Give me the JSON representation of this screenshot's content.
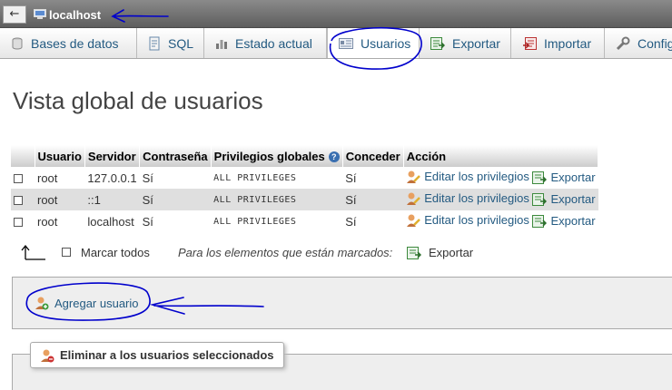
{
  "topbar": {
    "back_label": "←",
    "server_name": "localhost"
  },
  "tabs": [
    {
      "label": "Bases de datos",
      "icon": "database-icon"
    },
    {
      "label": "SQL",
      "icon": "sql-icon"
    },
    {
      "label": "Estado actual",
      "icon": "status-icon"
    },
    {
      "label": "Usuarios",
      "icon": "users-icon",
      "active": true
    },
    {
      "label": "Exportar",
      "icon": "export-icon"
    },
    {
      "label": "Importar",
      "icon": "import-icon"
    },
    {
      "label": "Configu",
      "icon": "wrench-icon"
    }
  ],
  "page": {
    "title": "Vista global de usuarios"
  },
  "table": {
    "headers": {
      "user": "Usuario",
      "host": "Servidor",
      "password": "Contraseña",
      "privileges": "Privilegios globales",
      "grant": "Conceder",
      "action": "Acción"
    },
    "rows": [
      {
        "user": "root",
        "host": "127.0.0.1",
        "password": "Sí",
        "privileges": "ALL PRIVILEGES",
        "grant": "Sí",
        "edit": "Editar los privilegios",
        "export": "Exportar"
      },
      {
        "user": "root",
        "host": "::1",
        "password": "Sí",
        "privileges": "ALL PRIVILEGES",
        "grant": "Sí",
        "edit": "Editar los privilegios",
        "export": "Exportar"
      },
      {
        "user": "root",
        "host": "localhost",
        "password": "Sí",
        "privileges": "ALL PRIVILEGES",
        "grant": "Sí",
        "edit": "Editar los privilegios",
        "export": "Exportar"
      }
    ]
  },
  "footer": {
    "check_all": "Marcar todos",
    "with_selected": "Para los elementos que están marcados:",
    "export": "Exportar"
  },
  "add_user": {
    "label": "Agregar usuario"
  },
  "delete_users": {
    "label": "Eliminar a los usuarios seleccionados"
  },
  "colors": {
    "link": "#235a81",
    "annotation": "#0000cc",
    "row_alt": "#dfdfdf"
  }
}
